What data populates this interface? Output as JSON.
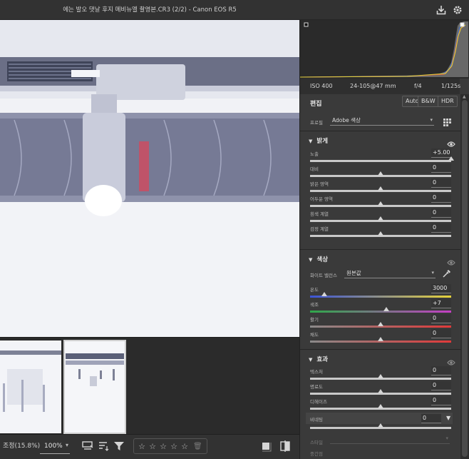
{
  "title": "에는 발오 댓날 후지 메비뉴엘 촬영본.CR3 (2/2)  -  Canon EOS R5",
  "camera": {
    "iso": "ISO 400",
    "lens": "24-105@47 mm",
    "aperture": "f/4",
    "shutter": "1/125s"
  },
  "edit": {
    "header": "편집",
    "buttons": {
      "auto": "Auto",
      "bw": "B&W",
      "hdr": "HDR"
    },
    "profile_label": "프로필",
    "profile_value": "Adobe 색상"
  },
  "light": {
    "title": "밝게",
    "sliders": [
      {
        "label": "노출",
        "value": "+5.00",
        "pos": 1.0
      },
      {
        "label": "대비",
        "value": "0",
        "pos": 0.5
      },
      {
        "label": "밝은 영역",
        "value": "0",
        "pos": 0.5
      },
      {
        "label": "어두운 영역",
        "value": "0",
        "pos": 0.5
      },
      {
        "label": "흰색 계열",
        "value": "0",
        "pos": 0.5
      },
      {
        "label": "검정 계열",
        "value": "0",
        "pos": 0.5
      }
    ]
  },
  "color": {
    "title": "색상",
    "wb_label": "화이트 밸런스",
    "wb_value": "원본값",
    "sliders": [
      {
        "label": "온도",
        "value": "3000",
        "pos": 0.1
      },
      {
        "label": "색조",
        "value": "+7",
        "pos": 0.54
      },
      {
        "label": "활기",
        "value": "0",
        "pos": 0.5
      },
      {
        "label": "채도",
        "value": "0",
        "pos": 0.5
      }
    ]
  },
  "effects": {
    "title": "효과",
    "sliders": [
      {
        "label": "텍스처",
        "value": "0",
        "pos": 0.5
      },
      {
        "label": "명료도",
        "value": "0",
        "pos": 0.5
      },
      {
        "label": "디헤이즈",
        "value": "0",
        "pos": 0.5
      }
    ],
    "vignette_label": "비네팅",
    "vignette_value": "0",
    "vignette_pos": 0.5,
    "style_label": "스타일",
    "midpoint_label": "중간점"
  },
  "bottom": {
    "zoom_label": "조정(15.8%)",
    "zoom_value": "100%",
    "stars": [
      "☆",
      "☆",
      "☆",
      "☆",
      "☆"
    ]
  },
  "colors": {
    "panel": "#3a3a3a",
    "accent": "#d6d6d6",
    "temp_grad": [
      "#3c54d6",
      "#e6d23a"
    ],
    "tint_grad": [
      "#2fa84a",
      "#c43fc4"
    ],
    "vib_grad": [
      "#8a8a8a",
      "#e03a3a"
    ]
  }
}
